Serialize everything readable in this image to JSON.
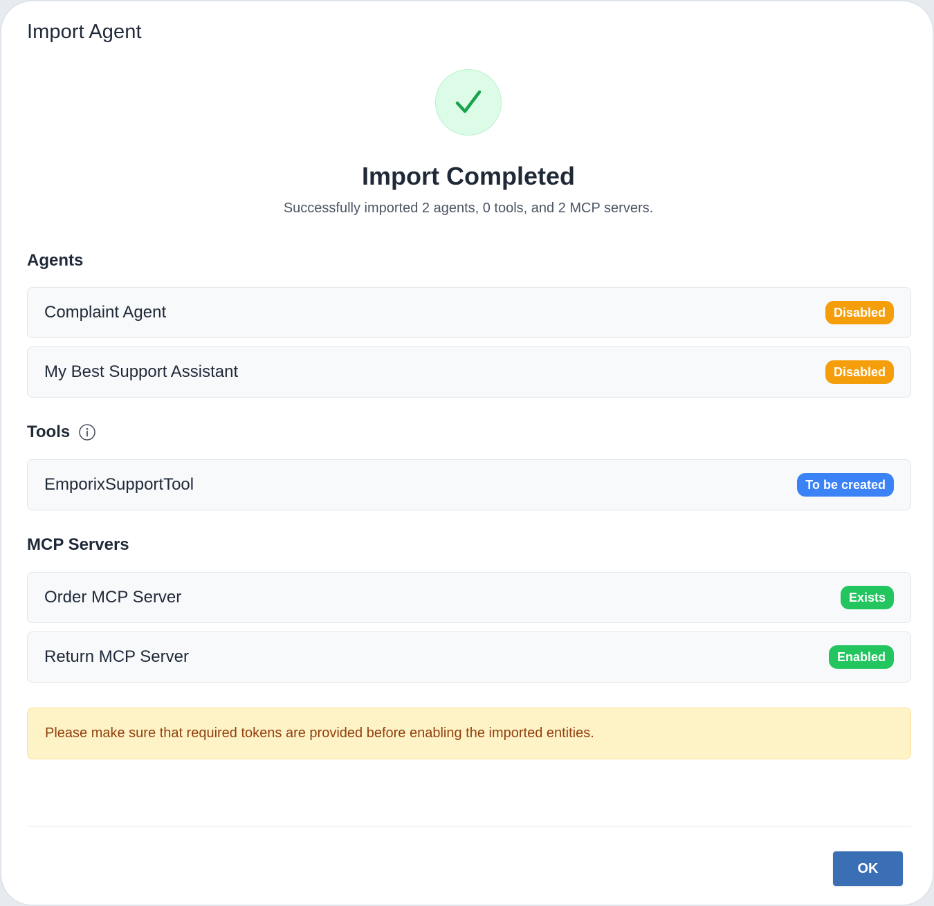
{
  "dialog": {
    "title": "Import Agent"
  },
  "result": {
    "icon": "check-icon",
    "heading": "Import Completed",
    "summary": "Successfully imported 2 agents, 0 tools, and 2 MCP servers."
  },
  "sections": {
    "agents": {
      "title": "Agents",
      "items": [
        {
          "name": "Complaint Agent",
          "status": "Disabled",
          "status_color": "#f59e0b"
        },
        {
          "name": "My Best Support Assistant",
          "status": "Disabled",
          "status_color": "#f59e0b"
        }
      ]
    },
    "tools": {
      "title": "Tools",
      "info_icon": "info-icon",
      "items": [
        {
          "name": "EmporixSupportTool",
          "status": "To be created",
          "status_color": "#3b82f6"
        }
      ]
    },
    "mcp_servers": {
      "title": "MCP Servers",
      "items": [
        {
          "name": "Order MCP Server",
          "status": "Exists",
          "status_color": "#22c55e"
        },
        {
          "name": "Return MCP Server",
          "status": "Enabled",
          "status_color": "#22c55e"
        }
      ]
    }
  },
  "notice": {
    "text": "Please make sure that required tokens are provided before enabling the imported entities."
  },
  "footer": {
    "ok_label": "OK"
  },
  "colors": {
    "accent": "#3b6fb5",
    "success": "#16a34a",
    "warning_bg": "#fef3c7",
    "warning_text": "#92400e"
  }
}
